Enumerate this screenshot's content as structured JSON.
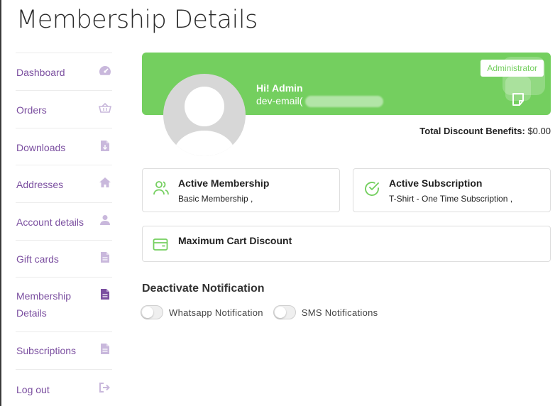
{
  "page_title": "Membership Details",
  "sidebar": {
    "items": [
      {
        "label": "Dashboard",
        "icon": "dashboard-gauge-icon"
      },
      {
        "label": "Orders",
        "icon": "basket-icon"
      },
      {
        "label": "Downloads",
        "icon": "file-download-icon"
      },
      {
        "label": "Addresses",
        "icon": "home-icon"
      },
      {
        "label": "Account details",
        "icon": "user-icon"
      },
      {
        "label": "Gift cards",
        "icon": "document-icon"
      },
      {
        "label": "Membership Details",
        "icon": "document-icon",
        "active": true
      },
      {
        "label": "Subscriptions",
        "icon": "document-icon"
      },
      {
        "label": "Log out",
        "icon": "logout-icon"
      }
    ]
  },
  "profile": {
    "role_badge": "Administrator",
    "greeting": "Hi! Admin",
    "email": "dev-email(",
    "banner_color": "#74cf5f"
  },
  "discount": {
    "label": "Total Discount Benefits:",
    "value": "$0.00"
  },
  "cards": {
    "active_membership": {
      "title": "Active Membership",
      "value": "Basic Membership ,"
    },
    "active_subscription": {
      "title": "Active Subscription",
      "value": "T-Shirt - One Time Subscription ,"
    },
    "max_cart_discount": {
      "title": "Maximum Cart Discount"
    }
  },
  "notifications": {
    "title": "Deactivate Notification",
    "whatsapp": "Whatsapp Notification",
    "sms": "SMS Notifications"
  },
  "colors": {
    "accent_green": "#74cf5f",
    "nav_purple": "#7b4fa0",
    "icon_lilac": "#c9b8dc"
  }
}
